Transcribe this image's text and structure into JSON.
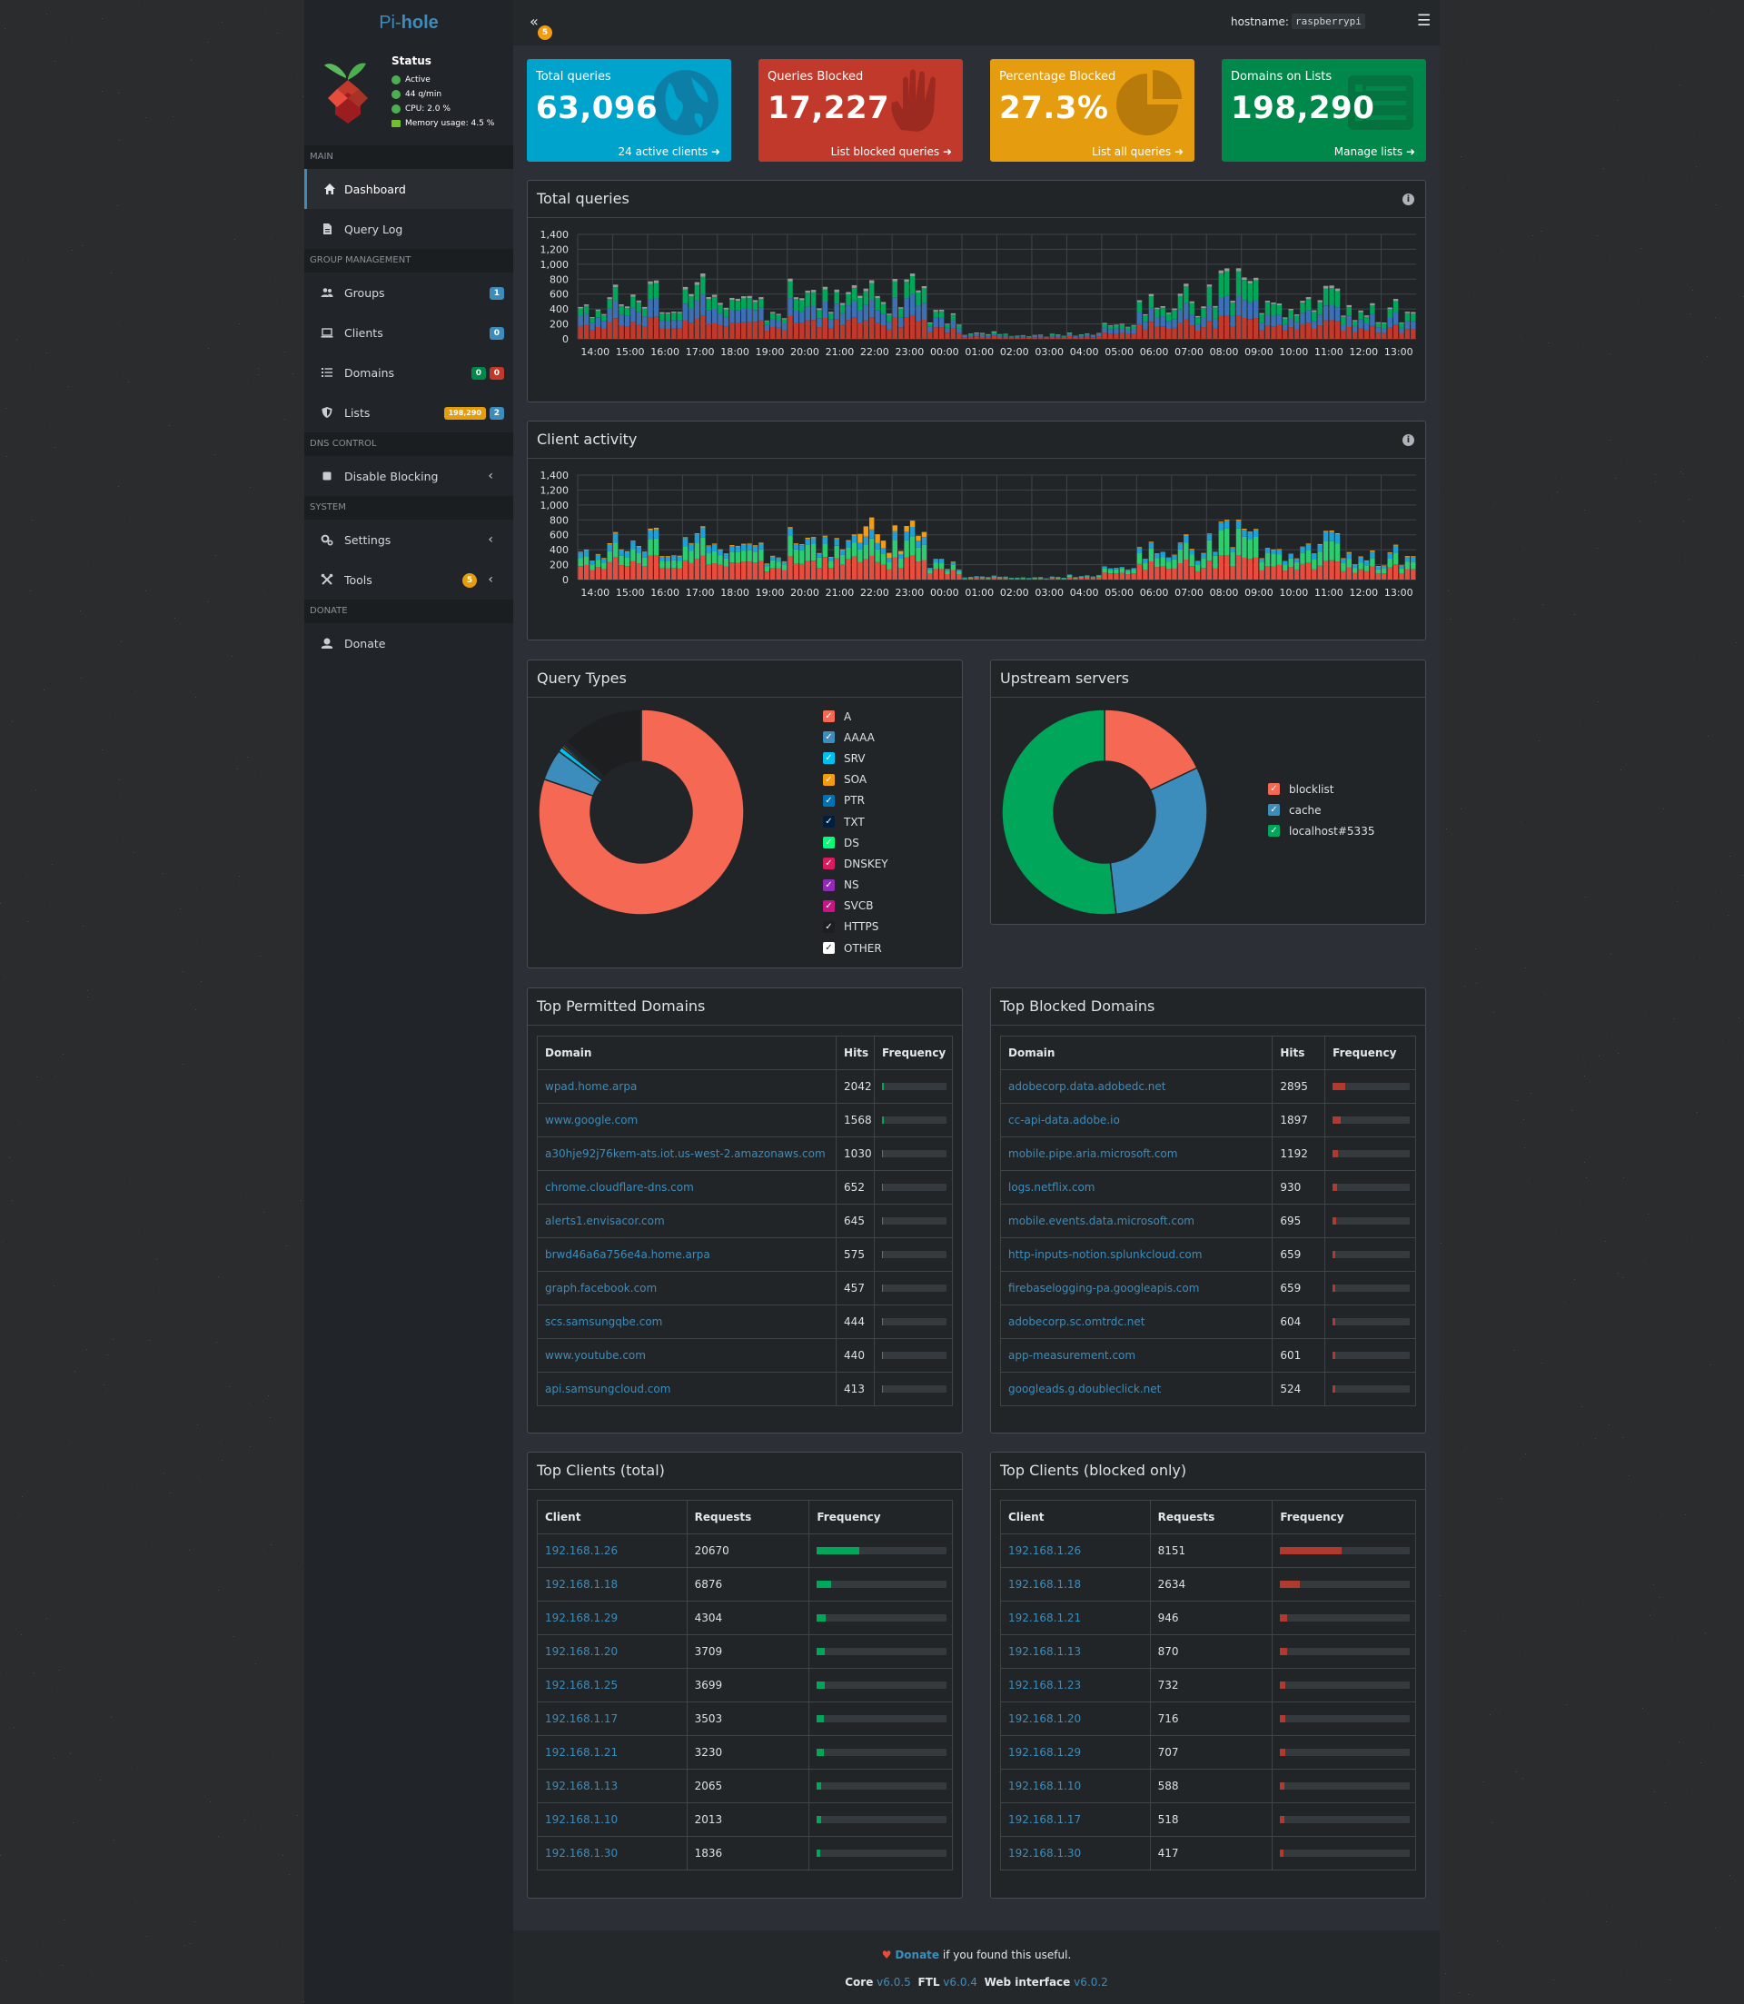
{
  "brand": {
    "prefix": "Pi-",
    "name": "hole"
  },
  "status": {
    "title": "Status",
    "active": "Active",
    "rate": "44 q/min",
    "cpu": "CPU: 2.0 %",
    "memory": "Memory usage: 4.5 %"
  },
  "sidebar": {
    "sections": {
      "main": "MAIN",
      "group": "GROUP MANAGEMENT",
      "dns": "DNS CONTROL",
      "system": "SYSTEM",
      "donate": "DONATE"
    },
    "items": {
      "dashboard": "Dashboard",
      "querylog": "Query Log",
      "groups": "Groups",
      "clients": "Clients",
      "domains": "Domains",
      "lists": "Lists",
      "disable": "Disable Blocking",
      "settings": "Settings",
      "tools": "Tools",
      "donate": "Donate"
    },
    "badges": {
      "groups": "1",
      "clients": "0",
      "domains_allow": "0",
      "domains_deny": "0",
      "lists_count": "198,290",
      "lists_total": "2",
      "tools": "5"
    }
  },
  "header": {
    "collapse_badge": "5",
    "host_label": "hostname:",
    "hostname": "raspberrypi"
  },
  "stats": [
    {
      "title": "Total queries",
      "value": "63,096",
      "footer": "24 active clients",
      "color": "#00a3cb"
    },
    {
      "title": "Queries Blocked",
      "value": "17,227",
      "footer": "List blocked queries",
      "color": "#c0392b"
    },
    {
      "title": "Percentage Blocked",
      "value": "27.3%",
      "footer": "List all queries",
      "color": "#e69c0f"
    },
    {
      "title": "Domains on Lists",
      "value": "198,290",
      "footer": "Manage lists",
      "color": "#00884a"
    }
  ],
  "panels": {
    "total_queries": "Total queries",
    "client_activity": "Client activity",
    "query_types": "Query Types",
    "upstream": "Upstream servers",
    "top_permitted": "Top Permitted Domains",
    "top_blocked": "Top Blocked Domains",
    "top_clients": "Top Clients (total)",
    "top_clients_blocked": "Top Clients (blocked only)"
  },
  "chart_data": [
    {
      "type": "bar",
      "stacked": true,
      "x": [
        "14:00",
        "15:00",
        "16:00",
        "17:00",
        "18:00",
        "19:00",
        "20:00",
        "21:00",
        "22:00",
        "23:00",
        "00:00",
        "01:00",
        "02:00",
        "03:00",
        "04:00",
        "05:00",
        "06:00",
        "07:00",
        "08:00",
        "09:00",
        "10:00",
        "11:00",
        "12:00",
        "13:00"
      ],
      "ylim": [
        0,
        1400
      ],
      "yticks": [
        "1,400",
        "1,200",
        "1,000",
        "800",
        "600",
        "400",
        "200",
        "0"
      ],
      "grid": true,
      "series": [
        {
          "color": "#c0392b",
          "values": [
            190,
            200,
            215,
            225,
            195,
            190,
            250,
            205,
            215,
            225,
            110,
            30,
            20,
            20,
            30,
            70,
            160,
            190,
            240,
            210,
            160,
            175,
            120,
            140
          ]
        },
        {
          "color": "#3c6fb4",
          "values": [
            150,
            170,
            180,
            200,
            160,
            130,
            190,
            160,
            180,
            200,
            90,
            25,
            15,
            15,
            25,
            60,
            130,
            150,
            200,
            180,
            120,
            140,
            110,
            120
          ]
        },
        {
          "color": "#00a65a",
          "values": [
            110,
            130,
            150,
            170,
            120,
            90,
            180,
            120,
            160,
            170,
            60,
            10,
            10,
            10,
            10,
            40,
            110,
            160,
            250,
            200,
            110,
            160,
            80,
            110
          ]
        },
        {
          "color": "#999999",
          "values": [
            20,
            25,
            25,
            30,
            25,
            20,
            30,
            25,
            30,
            25,
            15,
            10,
            5,
            5,
            5,
            10,
            20,
            25,
            30,
            25,
            20,
            25,
            20,
            20
          ]
        }
      ]
    },
    {
      "type": "bar",
      "stacked": true,
      "x": [
        "14:00",
        "15:00",
        "16:00",
        "17:00",
        "18:00",
        "19:00",
        "20:00",
        "21:00",
        "22:00",
        "23:00",
        "00:00",
        "01:00",
        "02:00",
        "03:00",
        "04:00",
        "05:00",
        "06:00",
        "07:00",
        "08:00",
        "09:00",
        "10:00",
        "11:00",
        "12:00",
        "13:00"
      ],
      "ylim": [
        0,
        1400
      ],
      "yticks": [
        "1,400",
        "1,200",
        "1,000",
        "800",
        "600",
        "400",
        "200",
        "0"
      ],
      "grid": true,
      "series": [
        {
          "color": "#e74c3c",
          "values": [
            200,
            220,
            240,
            230,
            210,
            190,
            250,
            220,
            240,
            230,
            100,
            20,
            15,
            15,
            30,
            80,
            170,
            190,
            250,
            220,
            170,
            180,
            120,
            150
          ]
        },
        {
          "color": "#2ecc71",
          "values": [
            120,
            140,
            160,
            170,
            130,
            120,
            220,
            130,
            170,
            180,
            60,
            10,
            10,
            10,
            15,
            50,
            120,
            160,
            270,
            210,
            120,
            180,
            80,
            110
          ]
        },
        {
          "color": "#1f9fd6",
          "values": [
            80,
            90,
            90,
            100,
            70,
            60,
            80,
            70,
            90,
            90,
            30,
            10,
            5,
            5,
            10,
            20,
            60,
            70,
            80,
            70,
            60,
            90,
            60,
            70
          ]
        },
        {
          "color": "#f39c12",
          "values": [
            10,
            10,
            15,
            10,
            10,
            10,
            15,
            10,
            120,
            60,
            5,
            0,
            0,
            0,
            0,
            0,
            5,
            10,
            10,
            10,
            5,
            10,
            10,
            10
          ]
        }
      ]
    },
    {
      "type": "pie",
      "donut": true,
      "labels": [
        "A",
        "AAAA",
        "SRV",
        "SOA",
        "PTR",
        "TXT",
        "DS",
        "DNSKEY",
        "NS",
        "SVCB",
        "HTTPS",
        "OTHER"
      ],
      "colors": [
        "#f56954",
        "#3c8dbc",
        "#00c0ef",
        "#f39c12",
        "#0073b7",
        "#001f3f",
        "#00ff77",
        "#d81b60",
        "#932ab6",
        "#c71585",
        "#000000",
        "#ffffff"
      ],
      "values": [
        80.2,
        4.9,
        0.8,
        0.3,
        0.3,
        0.1,
        0.1,
        0.1,
        0.1,
        0.2,
        12.8,
        0.1
      ]
    },
    {
      "type": "pie",
      "donut": true,
      "labels": [
        "blocklist",
        "cache",
        "localhost#5335"
      ],
      "colors": [
        "#f56954",
        "#3c8dbc",
        "#00a65a"
      ],
      "values": [
        17.9,
        30.3,
        51.8
      ]
    }
  ],
  "tables": {
    "permitted": {
      "headers": [
        "Domain",
        "Hits",
        "Frequency"
      ],
      "rows": [
        {
          "name": "wpad.home.arpa",
          "count": "2042",
          "pct": 0.032
        },
        {
          "name": "www.google.com",
          "count": "1568",
          "pct": 0.025
        },
        {
          "name": "a30hje92j76kem-ats.iot.us-west-2.amazonaws.com",
          "count": "1030",
          "pct": 0.016
        },
        {
          "name": "chrome.cloudflare-dns.com",
          "count": "652",
          "pct": 0.01
        },
        {
          "name": "alerts1.envisacor.com",
          "count": "645",
          "pct": 0.01
        },
        {
          "name": "brwd46a6a756e4a.home.arpa",
          "count": "575",
          "pct": 0.009
        },
        {
          "name": "graph.facebook.com",
          "count": "457",
          "pct": 0.007
        },
        {
          "name": "scs.samsungqbe.com",
          "count": "444",
          "pct": 0.007
        },
        {
          "name": "www.youtube.com",
          "count": "440",
          "pct": 0.007
        },
        {
          "name": "api.samsungcloud.com",
          "count": "413",
          "pct": 0.007
        }
      ]
    },
    "blocked": {
      "headers": [
        "Domain",
        "Hits",
        "Frequency"
      ],
      "rows": [
        {
          "name": "adobecorp.data.adobedc.net",
          "count": "2895",
          "pct": 0.168
        },
        {
          "name": "cc-api-data.adobe.io",
          "count": "1897",
          "pct": 0.11
        },
        {
          "name": "mobile.pipe.aria.microsoft.com",
          "count": "1192",
          "pct": 0.069
        },
        {
          "name": "logs.netflix.com",
          "count": "930",
          "pct": 0.054
        },
        {
          "name": "mobile.events.data.microsoft.com",
          "count": "695",
          "pct": 0.04
        },
        {
          "name": "http-inputs-notion.splunkcloud.com",
          "count": "659",
          "pct": 0.038
        },
        {
          "name": "firebaselogging-pa.googleapis.com",
          "count": "659",
          "pct": 0.038
        },
        {
          "name": "adobecorp.sc.omtrdc.net",
          "count": "604",
          "pct": 0.035
        },
        {
          "name": "app-measurement.com",
          "count": "601",
          "pct": 0.035
        },
        {
          "name": "googleads.g.doubleclick.net",
          "count": "524",
          "pct": 0.03
        }
      ]
    },
    "clients": {
      "headers": [
        "Client",
        "Requests",
        "Frequency"
      ],
      "rows": [
        {
          "name": "192.168.1.26",
          "count": "20670",
          "pct": 0.328
        },
        {
          "name": "192.168.1.18",
          "count": "6876",
          "pct": 0.109
        },
        {
          "name": "192.168.1.29",
          "count": "4304",
          "pct": 0.068
        },
        {
          "name": "192.168.1.20",
          "count": "3709",
          "pct": 0.059
        },
        {
          "name": "192.168.1.25",
          "count": "3699",
          "pct": 0.059
        },
        {
          "name": "192.168.1.17",
          "count": "3503",
          "pct": 0.056
        },
        {
          "name": "192.168.1.21",
          "count": "3230",
          "pct": 0.051
        },
        {
          "name": "192.168.1.13",
          "count": "2065",
          "pct": 0.033
        },
        {
          "name": "192.168.1.10",
          "count": "2013",
          "pct": 0.032
        },
        {
          "name": "192.168.1.30",
          "count": "1836",
          "pct": 0.029
        }
      ]
    },
    "clients_blocked": {
      "headers": [
        "Client",
        "Requests",
        "Frequency"
      ],
      "rows": [
        {
          "name": "192.168.1.26",
          "count": "8151",
          "pct": 0.473
        },
        {
          "name": "192.168.1.18",
          "count": "2634",
          "pct": 0.153
        },
        {
          "name": "192.168.1.21",
          "count": "946",
          "pct": 0.055
        },
        {
          "name": "192.168.1.13",
          "count": "870",
          "pct": 0.051
        },
        {
          "name": "192.168.1.23",
          "count": "732",
          "pct": 0.043
        },
        {
          "name": "192.168.1.20",
          "count": "716",
          "pct": 0.042
        },
        {
          "name": "192.168.1.29",
          "count": "707",
          "pct": 0.041
        },
        {
          "name": "192.168.1.10",
          "count": "588",
          "pct": 0.034
        },
        {
          "name": "192.168.1.17",
          "count": "518",
          "pct": 0.03
        },
        {
          "name": "192.168.1.30",
          "count": "417",
          "pct": 0.024
        }
      ]
    }
  },
  "footer": {
    "donate": "Donate",
    "donate_rest": " if you found this useful.",
    "core_label": "Core",
    "core_ver": "v6.0.5",
    "ftl_label": "FTL",
    "ftl_ver": "v6.0.4",
    "web_label": "Web interface",
    "web_ver": "v6.0.2"
  }
}
